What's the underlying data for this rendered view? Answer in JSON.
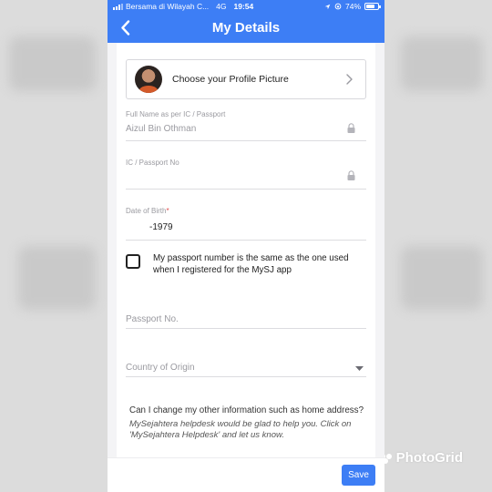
{
  "status_bar": {
    "carrier": "Bersama di Wilayah C...",
    "network": "4G",
    "time": "19:54",
    "battery": "74%",
    "battery_level": 0.74
  },
  "header": {
    "title": "My Details"
  },
  "profile": {
    "label": "Choose your Profile Picture"
  },
  "form": {
    "full_name": {
      "label": "Full Name as per IC / Passport",
      "value": "Aizul Bin Othman"
    },
    "ic_passport": {
      "label": "IC / Passport No",
      "value": ""
    },
    "dob": {
      "label": "Date of Birth",
      "required_mark": "*",
      "value": "-1979"
    },
    "same_passport": {
      "line1": "My passport number is the same as the one used",
      "line2": "when I registered for the MySJ app",
      "checked": false
    },
    "passport_no": {
      "placeholder": "Passport No."
    },
    "country": {
      "placeholder": "Country of Origin"
    }
  },
  "faq": {
    "question": "Can I change my other information such as home address?",
    "answer": "MySejahtera helpdesk would be glad to help you. Click on 'MySejahtera Helpdesk' and let us know."
  },
  "footer": {
    "save_label": "Save"
  },
  "watermark": {
    "text": "PhotoGrid"
  },
  "colors": {
    "primary": "#3d7ef5",
    "required": "#e24b4b"
  }
}
